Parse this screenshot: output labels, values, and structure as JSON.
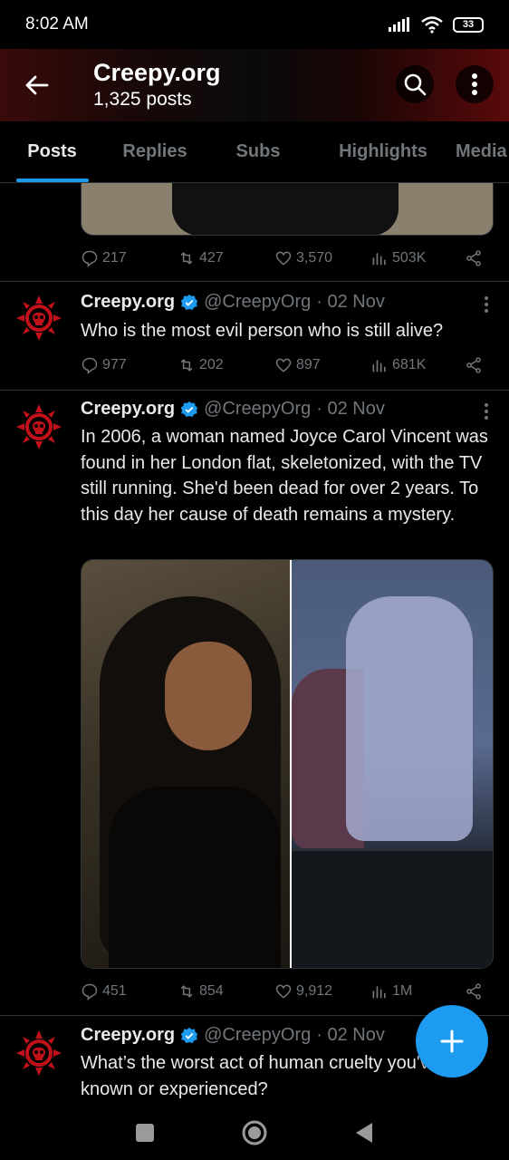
{
  "status_bar": {
    "time": "8:02 AM",
    "battery": "33"
  },
  "header": {
    "title": "Creepy.org",
    "subtitle": "1,325 posts"
  },
  "tabs": [
    {
      "label": "Posts",
      "active": true
    },
    {
      "label": "Replies"
    },
    {
      "label": "Subs"
    },
    {
      "label": "Highlights"
    },
    {
      "label": "Media"
    }
  ],
  "top_post": {
    "replies": "217",
    "reposts": "427",
    "likes": "3,570",
    "views": "503K"
  },
  "tweets": [
    {
      "name": "Creepy.org",
      "handle": "@CreepyOrg",
      "date": "· 02 Nov",
      "text": "Who is the most evil person who is still alive?",
      "replies": "977",
      "reposts": "202",
      "likes": "897",
      "views": "681K"
    },
    {
      "name": "Creepy.org",
      "handle": "@CreepyOrg",
      "date": "· 02 Nov",
      "text": "In 2006, a woman named Joyce Carol Vincent was found in her London flat, skeletonized, with the TV still running. She'd been dead for over 2 years. To this day her cause of death remains a mystery.",
      "replies": "451",
      "reposts": "854",
      "likes": "9,912",
      "views": "1M"
    },
    {
      "name": "Creepy.org",
      "handle": "@CreepyOrg",
      "date": "· 02 Nov",
      "text": "What’s the worst act of human cruelty you've known or experienced?"
    }
  ],
  "colors": {
    "accent": "#1d9bf0",
    "muted": "#71767b",
    "brand_red": "#c0101a"
  }
}
